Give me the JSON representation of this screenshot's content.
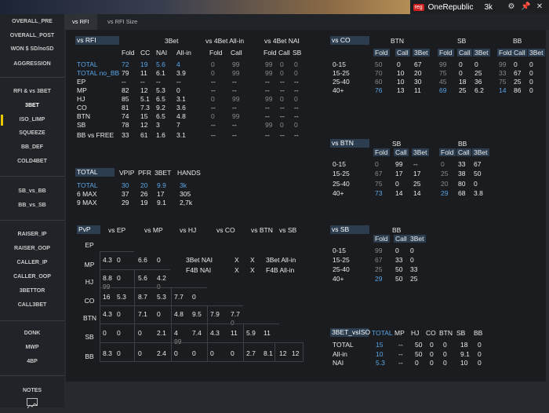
{
  "titlebar": {
    "player_name": "OneRepublic",
    "hands": "3k",
    "site_logo": "reg"
  },
  "sidebar": {
    "items": [
      {
        "label": "OVERALL_PRE"
      },
      {
        "label": "OVERALL_POST"
      },
      {
        "label": "WON $ SD/noSD"
      },
      {
        "label": "AGGRESSION"
      },
      {
        "label": "RFI & vs 3BET"
      },
      {
        "label": "3BET"
      },
      {
        "label": "ISO_LIMP"
      },
      {
        "label": "SQUEEZE"
      },
      {
        "label": "BB_DEF"
      },
      {
        "label": "COLD4BET"
      },
      {
        "label": "SB_vs_BB"
      },
      {
        "label": "BB_vs_SB"
      },
      {
        "label": "RAISER_IP"
      },
      {
        "label": "RAISER_OOP"
      },
      {
        "label": "CALLER_IP"
      },
      {
        "label": "CALLER_OOP"
      },
      {
        "label": "3BETTOR"
      },
      {
        "label": "CALL3BET"
      },
      {
        "label": "DONK"
      },
      {
        "label": "MWP"
      },
      {
        "label": "4BP"
      },
      {
        "label": "NOTES"
      }
    ]
  },
  "tabs": [
    {
      "label": "vs RFI"
    },
    {
      "label": "vs RFI Size"
    }
  ],
  "rfi": {
    "title": "vs RFI",
    "groups": [
      "3Bet",
      "vs 4Bet All-in",
      "vs 4Bet NAI"
    ],
    "cols": [
      "Fold",
      "CC",
      "NAI",
      "All-in",
      "Fold",
      "Call",
      "Fold",
      "Call",
      "SB"
    ],
    "rows": [
      {
        "label": "TOTAL",
        "v": [
          "72",
          "19",
          "5.6",
          "4",
          "0",
          "99",
          "99",
          "0",
          "0"
        ]
      },
      {
        "label": "TOTAL no_BB",
        "v": [
          "79",
          "11",
          "6.1",
          "3.9",
          "0",
          "99",
          "99",
          "0",
          "0"
        ]
      },
      {
        "label": "EP",
        "v": [
          "--",
          "--",
          "--",
          "--",
          "--",
          "--",
          "--",
          "--",
          "--"
        ]
      },
      {
        "label": "MP",
        "v": [
          "82",
          "12",
          "5.3",
          "0",
          "--",
          "--",
          "--",
          "--",
          "--"
        ]
      },
      {
        "label": "HJ",
        "v": [
          "85",
          "5.1",
          "6.5",
          "3.1",
          "0",
          "99",
          "99",
          "0",
          "0"
        ]
      },
      {
        "label": "CO",
        "v": [
          "81",
          "7.3",
          "9.2",
          "3.6",
          "--",
          "--",
          "--",
          "--",
          "--"
        ]
      },
      {
        "label": "BTN",
        "v": [
          "74",
          "15",
          "6.5",
          "4.8",
          "0",
          "99",
          "--",
          "--",
          "--"
        ]
      },
      {
        "label": "SB",
        "v": [
          "78",
          "12",
          "3",
          "7",
          "--",
          "--",
          "99",
          "0",
          "0"
        ]
      },
      {
        "label": "BB vs FREE",
        "v": [
          "33",
          "61",
          "1.6",
          "3.1",
          "--",
          "--",
          "--",
          "--",
          "--"
        ]
      }
    ]
  },
  "vsco": {
    "title": "vs CO",
    "groups": [
      "BTN",
      "SB",
      "BB"
    ],
    "cols": [
      "Fold",
      "Call",
      "3Bet",
      "Fold",
      "Call",
      "3Bet",
      "Fold",
      "Call",
      "3Bet"
    ],
    "rows": [
      {
        "label": "0-15",
        "v": [
          "50",
          "0",
          "67",
          "99",
          "0",
          "0",
          "99",
          "0",
          "0"
        ]
      },
      {
        "label": "15-25",
        "v": [
          "70",
          "10",
          "20",
          "75",
          "0",
          "25",
          "33",
          "67",
          "0"
        ]
      },
      {
        "label": "25-40",
        "v": [
          "60",
          "10",
          "30",
          "45",
          "18",
          "36",
          "75",
          "25",
          "0"
        ]
      },
      {
        "label": "40+",
        "v": [
          "76",
          "13",
          "11",
          "69",
          "25",
          "6.2",
          "14",
          "86",
          "0"
        ]
      }
    ]
  },
  "vsbtn": {
    "title": "vs BTN",
    "groups": [
      "SB",
      "BB"
    ],
    "cols": [
      "Fold",
      "Call",
      "3Bet",
      "Fold",
      "Call",
      "3Bet"
    ],
    "rows": [
      {
        "label": "0-15",
        "v": [
          "0",
          "99",
          "--",
          "0",
          "33",
          "67"
        ]
      },
      {
        "label": "15-25",
        "v": [
          "67",
          "17",
          "17",
          "25",
          "38",
          "50"
        ]
      },
      {
        "label": "25-40",
        "v": [
          "75",
          "0",
          "25",
          "20",
          "80",
          "0"
        ]
      },
      {
        "label": "40+",
        "v": [
          "73",
          "14",
          "14",
          "29",
          "68",
          "3.8"
        ]
      }
    ]
  },
  "vssb": {
    "title": "vs SB",
    "groups": [
      "BB"
    ],
    "cols": [
      "Fold",
      "Call",
      "3Bet"
    ],
    "rows": [
      {
        "label": "0-15",
        "v": [
          "99",
          "0",
          "0"
        ]
      },
      {
        "label": "15-25",
        "v": [
          "67",
          "33",
          "0"
        ]
      },
      {
        "label": "25-40",
        "v": [
          "25",
          "50",
          "33"
        ]
      },
      {
        "label": "40+",
        "v": [
          "29",
          "50",
          "25"
        ]
      }
    ]
  },
  "totals": {
    "cols": [
      "TOTAL",
      "VPIP",
      "PFR",
      "3BET",
      "HANDS"
    ],
    "rows": [
      {
        "label": "TOTAL",
        "v": [
          "30",
          "20",
          "9.9",
          "3k"
        ]
      },
      {
        "label": "6 MAX",
        "v": [
          "37",
          "26",
          "17",
          "305"
        ]
      },
      {
        "label": "9 MAX",
        "v": [
          "29",
          "19",
          "9.1",
          "2,7k"
        ]
      }
    ]
  },
  "pvp": {
    "title": "PvP",
    "cols": [
      "vs EP",
      "vs MP",
      "vs HJ",
      "vs CO",
      "vs BTN",
      "vs SB"
    ],
    "rows": [
      "EP",
      "MP",
      "HJ",
      "CO",
      "BTN",
      "SB",
      "BB"
    ],
    "cells": [
      [
        "",
        "",
        "",
        "",
        "",
        "",
        "",
        "",
        "",
        "",
        "",
        ""
      ],
      [
        "4.3",
        "0",
        "6.6",
        "0",
        "",
        "",
        "",
        "",
        "",
        "",
        "",
        ""
      ],
      [
        "8.8",
        "0",
        "5.6",
        "4.2",
        "",
        "",
        "",
        "",
        "",
        "",
        "",
        ""
      ],
      [
        "16",
        "5.3",
        "8.7",
        "5.3",
        "7.7",
        "0",
        "",
        "",
        "",
        "",
        "",
        ""
      ],
      [
        "4.3",
        "0",
        "7.1",
        "0",
        "4.8",
        "9.5",
        "7.9",
        "7.7",
        "",
        "",
        "",
        ""
      ],
      [
        "0",
        "0",
        "0",
        "2.1",
        "4",
        "7.4",
        "4.3",
        "11",
        "5.9",
        "11",
        "",
        ""
      ],
      [
        "8.3",
        "0",
        "0",
        "2.4",
        "0",
        "0",
        "0",
        "0",
        "2.7",
        "8.1",
        "12",
        "12"
      ]
    ],
    "sub_cells": [
      [
        "",
        "",
        "",
        "",
        "",
        "",
        "",
        "",
        "",
        "",
        "",
        ""
      ],
      [
        "",
        "",
        "",
        "",
        "",
        "",
        "",
        "",
        "",
        "",
        "",
        ""
      ],
      [
        "99",
        "",
        "",
        "0",
        "",
        "",
        "",
        "",
        "",
        "",
        "",
        ""
      ],
      [
        "",
        "",
        "",
        "",
        "",
        "",
        "",
        "",
        "",
        "",
        "",
        ""
      ],
      [
        "",
        "",
        "",
        "",
        "",
        "",
        "",
        "0",
        "",
        "",
        "",
        ""
      ],
      [
        "",
        "",
        "",
        "",
        "99",
        "",
        "",
        "",
        "",
        "",
        "",
        ""
      ],
      [
        "",
        "",
        "",
        "",
        "",
        "",
        "",
        "",
        "",
        "",
        "",
        ""
      ]
    ],
    "legend": [
      {
        "left": "3Bet NAI",
        "a": "X",
        "b": "X",
        "right": "3Bet All-in"
      },
      {
        "left": "F4B NAI",
        "a": "X",
        "b": "X",
        "right": "F4B All-in"
      }
    ]
  },
  "iso": {
    "title": "3BET_vsISO",
    "cols": [
      "TOTAL",
      "MP",
      "HJ",
      "CO",
      "BTN",
      "SB",
      "BB"
    ],
    "rows": [
      {
        "label": "TOTAL",
        "v": [
          "15",
          "--",
          "50",
          "0",
          "0",
          "18",
          "0"
        ]
      },
      {
        "label": "All-in",
        "v": [
          "10",
          "--",
          "50",
          "0",
          "0",
          "9.1",
          "0"
        ]
      },
      {
        "label": "NAI",
        "v": [
          "5.3",
          "--",
          "0",
          "0",
          "0",
          "10",
          "0"
        ]
      }
    ]
  }
}
